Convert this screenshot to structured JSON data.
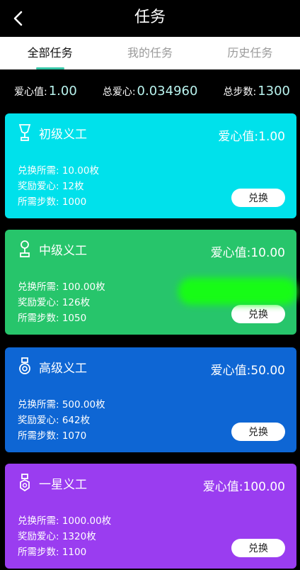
{
  "header": {
    "title": "任务"
  },
  "tabs": [
    {
      "label": "全部任务",
      "active": true
    },
    {
      "label": "我的任务",
      "active": false
    },
    {
      "label": "历史任务",
      "active": false
    }
  ],
  "stats": [
    {
      "label": "爱心值:",
      "value": "1.00"
    },
    {
      "label": "总爱心:",
      "value": "0.034960"
    },
    {
      "label": "总步数:",
      "value": "1300"
    }
  ],
  "cards": [
    {
      "name": "初级义工",
      "love_label": "爱心值:",
      "love_value": "1.00",
      "lines": [
        "兑换所需: 10.00枚",
        "奖励爱心: 12枚",
        "所需步数: 1000"
      ],
      "button": "兑换",
      "color": "#00e1eb"
    },
    {
      "name": "中级义工",
      "love_label": "爱心值:",
      "love_value": "10.00",
      "lines": [
        "兑换所需: 100.00枚",
        "奖励爱心: 126枚",
        "所需步数: 1050"
      ],
      "button": "兑换",
      "color": "#27c56b"
    },
    {
      "name": "高级义工",
      "love_label": "爱心值:",
      "love_value": "50.00",
      "lines": [
        "兑换所需: 500.00枚",
        "奖励爱心: 642枚",
        "所需步数: 1070"
      ],
      "button": "兑换",
      "color": "#0e66d4"
    },
    {
      "name": "一星义工",
      "love_label": "爱心值:",
      "love_value": "100.00",
      "lines": [
        "兑换所需: 1000.00枚",
        "奖励爱心: 1320枚",
        "所需步数: 1100"
      ],
      "button": "兑换",
      "color": "#9a3df0"
    }
  ],
  "icons": {
    "back": "chevron-left-icon",
    "card_1": "trophy-icon",
    "card_2": "trophy-icon",
    "card_3": "medal-icon",
    "card_4": "medal-icon"
  },
  "colors": {
    "tab_active_underline": "#37c6a7",
    "stat_value": "#b9f3ee"
  }
}
